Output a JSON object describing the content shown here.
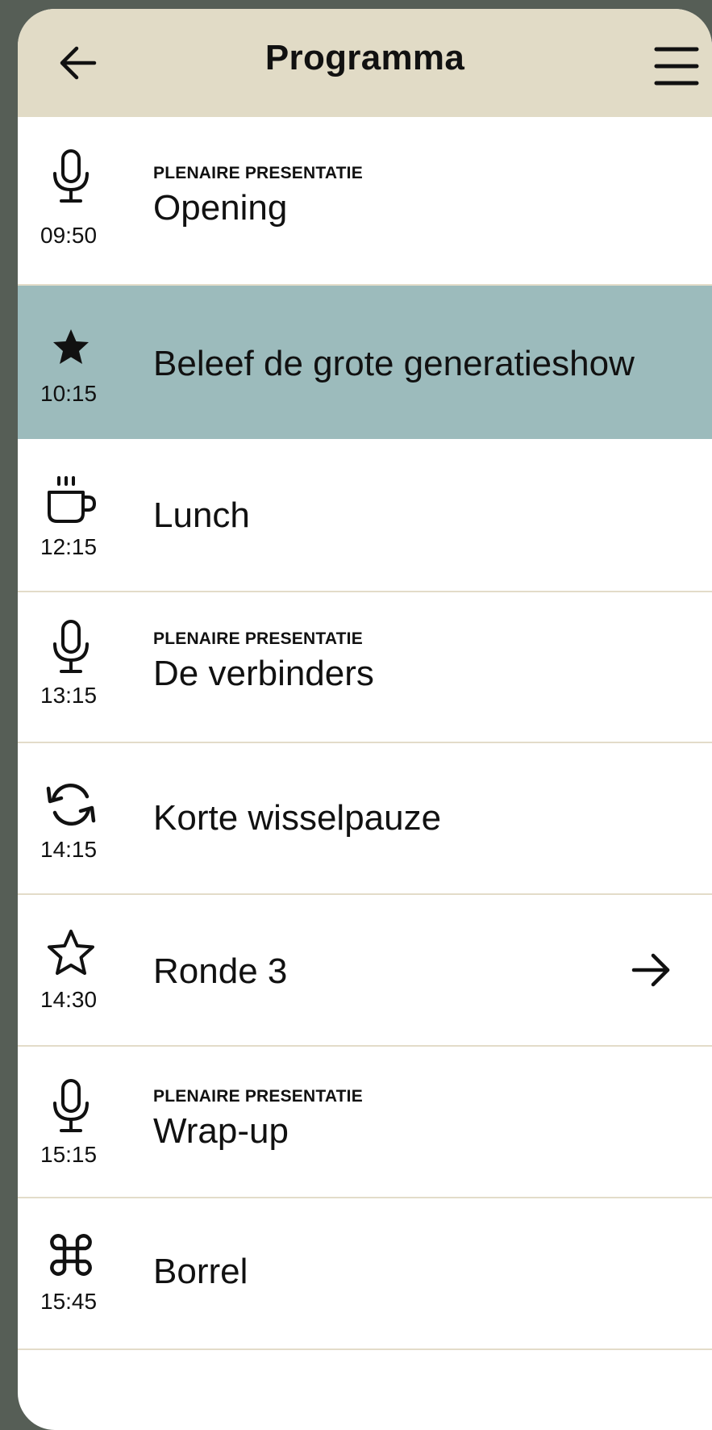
{
  "colors": {
    "header_bg": "#e1dbc6",
    "active_row_bg": "#9cbbbc",
    "outer_bg": "#565e56",
    "divider": "#e3dcc9"
  },
  "header": {
    "title": "Programma",
    "back_icon": "arrow-left-icon",
    "menu_icon": "hamburger-menu-icon"
  },
  "items": [
    {
      "time": "09:50",
      "icon": "microphone-icon",
      "kicker": "PLENAIRE PRESENTATIE",
      "label": "Opening",
      "active": false
    },
    {
      "time": "10:15",
      "icon": "star-filled-icon",
      "kicker": "",
      "label": "Beleef de grote generatieshow",
      "active": true
    },
    {
      "time": "12:15",
      "icon": "coffee-cup-icon",
      "kicker": "",
      "label": "Lunch",
      "active": false
    },
    {
      "time": "13:15",
      "icon": "microphone-icon",
      "kicker": "PLENAIRE PRESENTATIE",
      "label": "De verbinders",
      "active": false
    },
    {
      "time": "14:15",
      "icon": "refresh-icon",
      "kicker": "",
      "label": "Korte wisselpauze",
      "active": false
    },
    {
      "time": "14:30",
      "icon": "star-outline-icon",
      "kicker": "",
      "label": "Ronde 3",
      "active": false,
      "trailing_icon": "arrow-right-icon"
    },
    {
      "time": "15:15",
      "icon": "microphone-icon",
      "kicker": "PLENAIRE PRESENTATIE",
      "label": "Wrap-up",
      "active": false
    },
    {
      "time": "15:45",
      "icon": "command-icon",
      "kicker": "",
      "label": "Borrel",
      "active": false
    }
  ]
}
